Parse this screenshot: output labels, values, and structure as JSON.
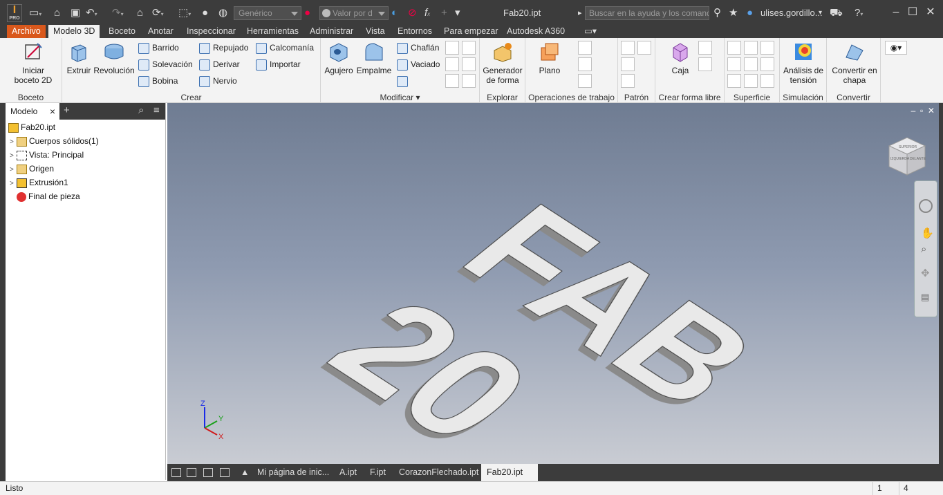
{
  "titlebar": {
    "logo_letter": "I",
    "logo_sub": "PRO",
    "material": "Genérico",
    "appearance": "Valor por d",
    "doc_title": "Fab20.ipt",
    "search_placeholder": "Buscar en la ayuda y los comandos",
    "user": "ulises.gordillo...",
    "help_icon": "question-icon"
  },
  "menu_tabs": [
    "Archivo",
    "Modelo 3D",
    "Boceto",
    "Anotar",
    "Inspeccionar",
    "Herramientas",
    "Administrar",
    "Vista",
    "Entornos",
    "Para empezar",
    "Autodesk A360"
  ],
  "ribbon": {
    "boceto": {
      "label": "Boceto",
      "start_sketch": "Iniciar boceto 2D"
    },
    "crear": {
      "label": "Crear",
      "extrude": "Extruir",
      "revolve": "Revolución",
      "sweep": "Barrido",
      "loft": "Solevación",
      "coil": "Bobina",
      "emboss": "Repujado",
      "derive": "Derivar",
      "rib": "Nervio",
      "decal": "Calcomanía",
      "import": "Importar"
    },
    "modificar": {
      "label": "Modificar",
      "hole": "Agujero",
      "fillet": "Empalme",
      "chamfer": "Chaflán",
      "shell": "Vaciado"
    },
    "explorar": {
      "label": "Explorar",
      "shape_gen": "Generador de forma"
    },
    "operaciones": {
      "label": "Operaciones de trabajo",
      "plane": "Plano"
    },
    "patron": {
      "label": "Patrón"
    },
    "forma_libre": {
      "label": "Crear forma libre",
      "box": "Caja"
    },
    "superficie": {
      "label": "Superficie"
    },
    "simulacion": {
      "label": "Simulación",
      "stress": "Análisis de tensión"
    },
    "convertir": {
      "label": "Convertir",
      "sheet": "Convertir en chapa"
    }
  },
  "browser": {
    "tab": "Modelo",
    "items": [
      {
        "label": "Fab20.ipt"
      },
      {
        "label": "Cuerpos sólidos(1)"
      },
      {
        "label": "Vista: Principal"
      },
      {
        "label": "Origen"
      },
      {
        "label": "Extrusión1"
      },
      {
        "label": "Final de pieza"
      }
    ]
  },
  "model_text": {
    "top": "FAB",
    "bottom": "20"
  },
  "viewcube": {
    "faces": [
      "SUPERIOR",
      "IZQUIERDA",
      "DELANTE"
    ]
  },
  "triad": {
    "x": "X",
    "y": "Y",
    "z": "Z"
  },
  "doc_tabs": [
    "Mi página de inic...",
    "A.ipt",
    "F.ipt",
    "CorazonFlechado.ipt",
    "Fab20.ipt"
  ],
  "status": {
    "text": "Listo",
    "num1": "1",
    "num2": "4"
  },
  "colors": {
    "accent": "#d9581c",
    "dark_ui": "#3c3c3c",
    "ribbon_bg": "#f3f3f3"
  }
}
